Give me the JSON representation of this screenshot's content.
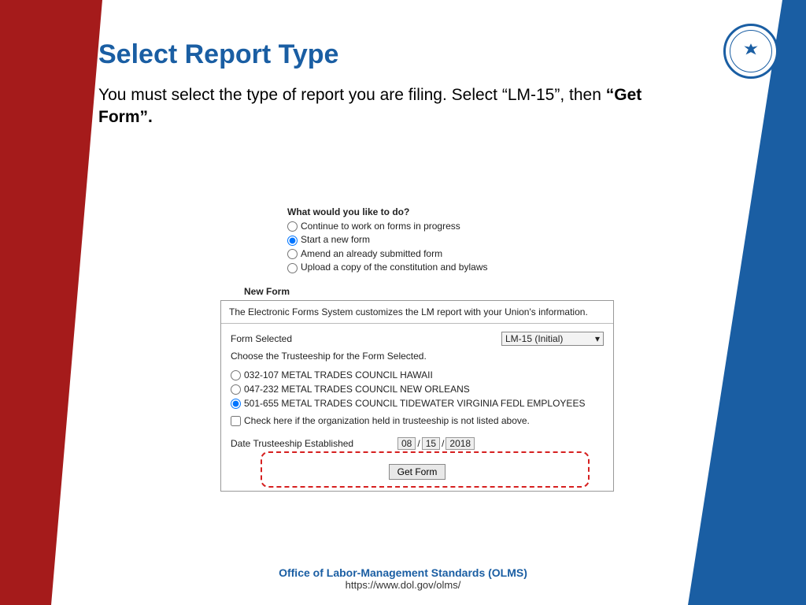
{
  "title": "Select Report Type",
  "intro_plain": "You must select the type of report you are filing.  Select “LM-15”, then ",
  "intro_bold": "“Get Form”.",
  "question": "What would you like to do?",
  "opts": {
    "a": "Continue to work on forms in progress",
    "b": "Start a new form",
    "c": "Amend an already submitted form",
    "d": "Upload a copy of the constitution and bylaws"
  },
  "newform_heading": "New Form",
  "panel_desc": "The Electronic Forms System customizes the LM report with your Union's information.",
  "form_selected_label": "Form Selected",
  "form_selected_value": "LM-15 (Initial)",
  "choose_text": "Choose the Trusteeship for the Form Selected.",
  "trust": {
    "a": "032-107 METAL TRADES COUNCIL HAWAII",
    "b": "047-232 METAL TRADES COUNCIL NEW ORLEANS",
    "c": "501-655 METAL TRADES COUNCIL TIDEWATER VIRGINIA FEDL EMPLOYEES"
  },
  "not_listed": "Check here if the organization held in trusteeship is not listed above.",
  "date_label": "Date Trusteeship Established",
  "date": {
    "mm": "08",
    "dd": "15",
    "yyyy": "2018"
  },
  "get_form": "Get Form",
  "footer1": "Office of Labor-Management Standards (OLMS)",
  "footer2": "https://www.dol.gov/olms/"
}
